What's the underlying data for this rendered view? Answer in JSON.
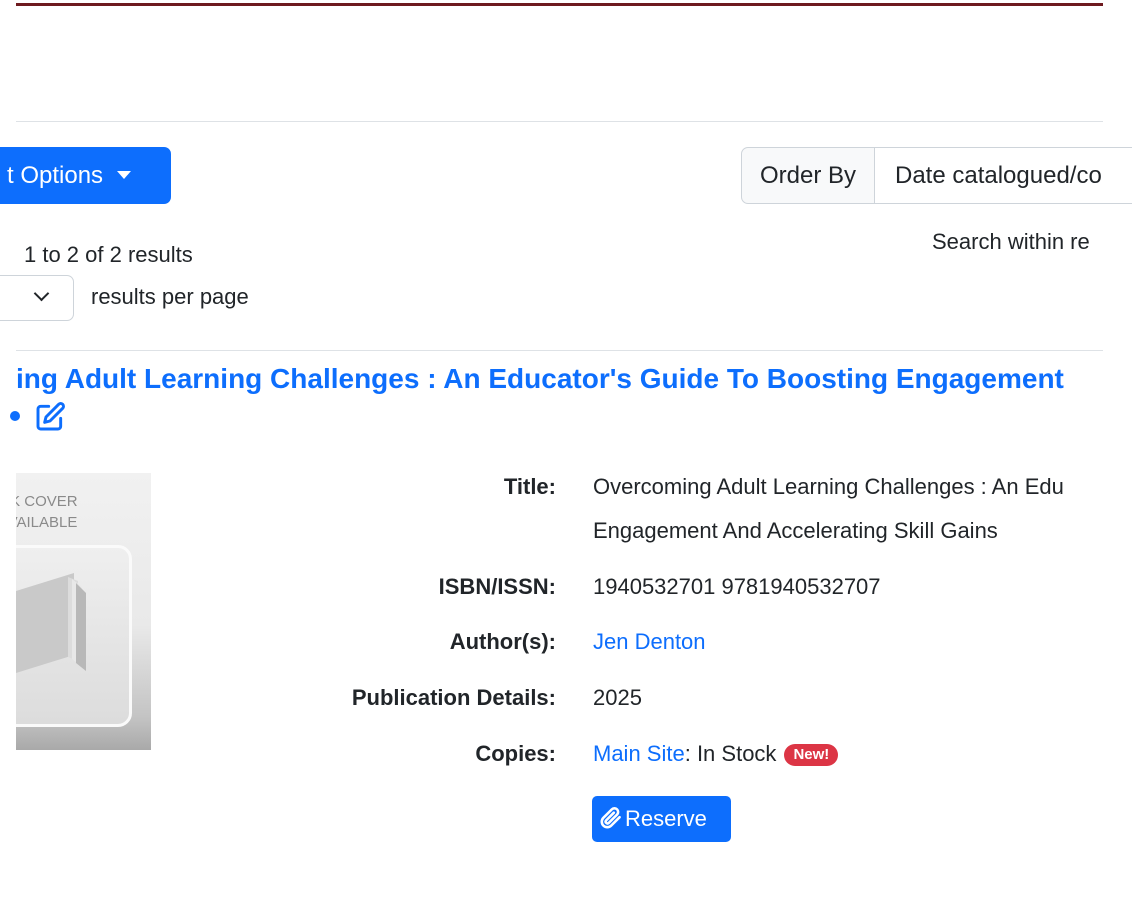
{
  "toolbar": {
    "options_label": "t Options",
    "order_by_label": "Order By",
    "order_by_value": "Date catalogued/co"
  },
  "results": {
    "summary": "1 to 2 of 2 results",
    "per_page_label": "results per page",
    "search_within_label": "Search within re"
  },
  "record": {
    "heading": "ing Adult Learning Challenges : An Educator's Guide To Boosting Engagement",
    "cover_text_line1": "OK COVER",
    "cover_text_line2": "AVAILABLE",
    "fields": {
      "title_label": "Title:",
      "title_line1": "Overcoming Adult Learning Challenges : An Edu",
      "title_line2": "Engagement And Accelerating Skill Gains",
      "isbn_label": "ISBN/ISSN:",
      "isbn_value": "1940532701 9781940532707",
      "author_label": "Author(s):",
      "author_value": "Jen Denton",
      "pub_label": "Publication Details:",
      "pub_value": "2025",
      "copies_label": "Copies:",
      "copies_site": "Main Site",
      "copies_status": ": In Stock",
      "new_badge": "New!"
    },
    "reserve_label": "Reserve"
  },
  "colors": {
    "primary": "#0d6efd",
    "top_bar": "#6e1a1f",
    "badge": "#dc3545"
  }
}
